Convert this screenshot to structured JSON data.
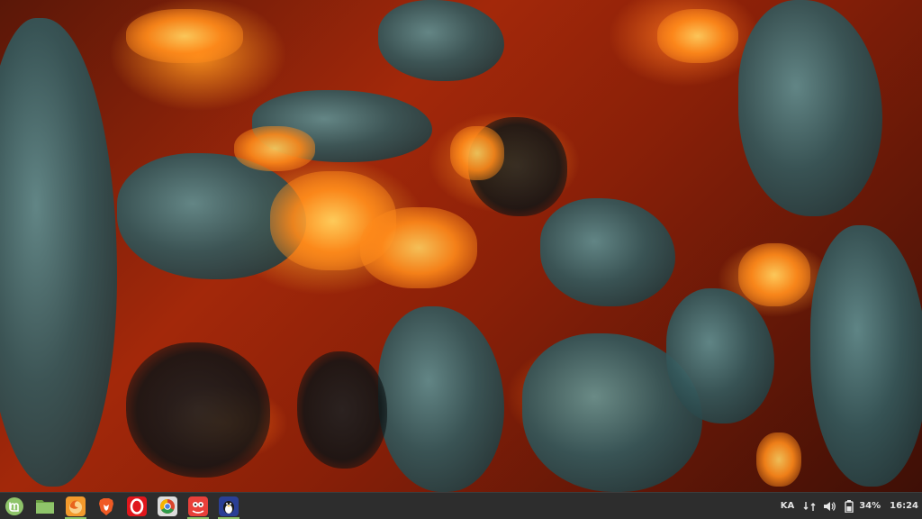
{
  "desktop": {
    "wallpaper": "glowing-embers-photo"
  },
  "taskbar": {
    "menu": {
      "icon": "linux-mint-logo-icon",
      "color": "#8fc46a"
    },
    "launchers": [
      {
        "icon": "files-folder-icon",
        "color": "#7fb352",
        "running": false
      },
      {
        "icon": "firefox-icon",
        "color": "#f39a2c",
        "running": true
      },
      {
        "icon": "brave-browser-icon",
        "color": "#f05a24",
        "running": false
      },
      {
        "icon": "opera-browser-icon",
        "color": "#e0161c",
        "running": false
      },
      {
        "icon": "chromium-browser-icon",
        "color": "#dcdcdc",
        "running": false
      },
      {
        "icon": "gimp-icon",
        "color": "#e8403a",
        "running": true
      },
      {
        "icon": "tux-app-icon",
        "color": "#2a3f95",
        "running": true
      }
    ],
    "tray": {
      "keyboard_layout": "KA",
      "battery_percent": "34%",
      "clock": "16:24"
    }
  }
}
